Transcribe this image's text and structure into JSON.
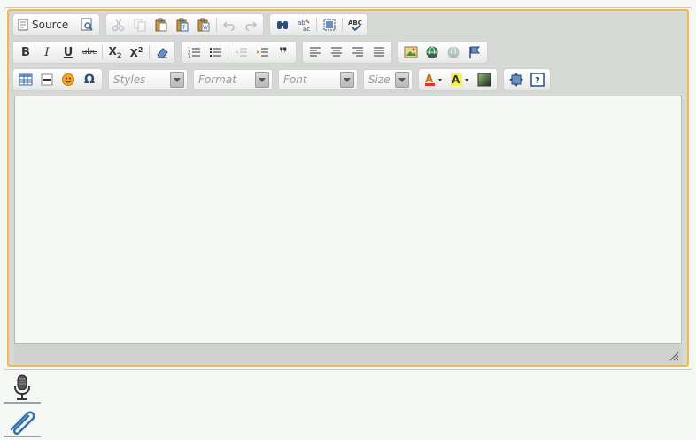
{
  "toolbar": {
    "source_label": "Source",
    "styles_placeholder": "Styles",
    "format_placeholder": "Format",
    "font_placeholder": "Font",
    "size_placeholder": "Size",
    "bold": "B",
    "italic": "I",
    "underline": "U",
    "strike": "abc",
    "subscript": "X",
    "subscript_sub": "2",
    "superscript": "X",
    "superscript_sup": "2",
    "blockquote": "❞",
    "text_color_letter": "A",
    "bg_color_letter": "A",
    "spellcheck_label": "ABC",
    "help_label": "?"
  },
  "editor": {
    "content": ""
  },
  "side": {
    "icons": [
      "microphone-icon",
      "paperclip-icon"
    ]
  },
  "colors": {
    "focus_border": "#f2b84b",
    "toolbar_bg": "#d6d8d6",
    "content_bg": "#f6f8f6"
  }
}
